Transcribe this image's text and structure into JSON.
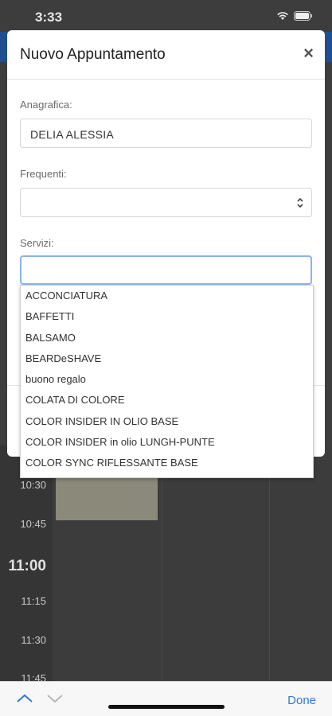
{
  "status_bar": {
    "time": "3:33"
  },
  "modal": {
    "title": "Nuovo Appuntamento",
    "close_label": "×",
    "anagrafica": {
      "label": "Anagrafica:",
      "value": "DELIA ALESSIA"
    },
    "frequenti": {
      "label": "Frequenti:",
      "value": ""
    },
    "servizi": {
      "label": "Servizi:",
      "value": ""
    }
  },
  "services_dropdown": [
    "ACCONCIATURA",
    "BAFFETTI",
    "BALSAMO",
    "BEARDeSHAVE",
    "buono regalo",
    "COLATA DI COLORE",
    "COLOR INSIDER IN OLIO BASE",
    "COLOR INSIDER in olio LUNGH-PUNTE",
    "COLOR SYNC RIFLESSANTE BASE"
  ],
  "calendar": {
    "times": [
      "10:30",
      "10:45",
      "11:00",
      "11:15",
      "11:30",
      "11:45"
    ]
  },
  "keyboard_bar": {
    "done_label": "Done"
  },
  "colors": {
    "accent": "#2f7bd8",
    "header": "#1f4f8f",
    "event": "#8a897a"
  }
}
